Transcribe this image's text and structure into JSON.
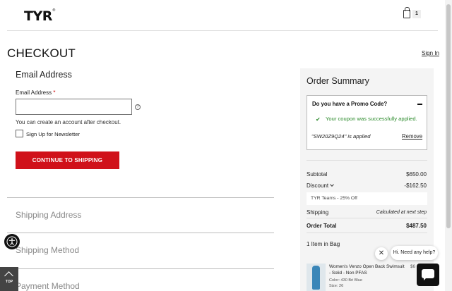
{
  "header": {
    "logo": "TYR",
    "logo_mark": "®",
    "cart_count": "1"
  },
  "page": {
    "title": "CHECKOUT",
    "signin": "Sign In"
  },
  "email_section": {
    "title": "Email Address",
    "label": "Email Address",
    "required_mark": "*",
    "value": "",
    "help": "?",
    "hint": "You can create an account after checkout.",
    "newsletter_label": "Sign Up for Newsletter",
    "newsletter_checked": false,
    "continue_button": "CONTINUE TO SHIPPING"
  },
  "steps": [
    "Shipping Address",
    "Shipping Method",
    "Payment Method"
  ],
  "summary": {
    "title": "Order Summary",
    "promo": {
      "question": "Do you have a Promo Code?",
      "success": "Your coupon was successfully applied.",
      "applied": "\"SW20Z9Q24\" is applied",
      "remove": "Remove"
    },
    "subtotal_label": "Subtotal",
    "subtotal": "$650.00",
    "discount_label": "Discount",
    "discount": "-$162.50",
    "discount_detail": "TYR Teams - 25% Off",
    "shipping_label": "Shipping",
    "shipping": "Calculated at next step",
    "total_label": "Order Total",
    "total": "$487.50",
    "items_label": "1 Item in Bag",
    "item": {
      "name": "Women's Venzo Open Back Swimsuit - Solid - Non PFAS",
      "price": "$6",
      "color": "Color: 430 Bri Blue",
      "size": "Size: 26"
    }
  },
  "chat": {
    "prompt": "Hi. Need any help?",
    "close": "✕"
  },
  "widgets": {
    "top": "TOP"
  },
  "colors": {
    "primary_button": "#d0111a",
    "success": "#2a8a2a",
    "summary_bg": "#f4f4f4"
  }
}
